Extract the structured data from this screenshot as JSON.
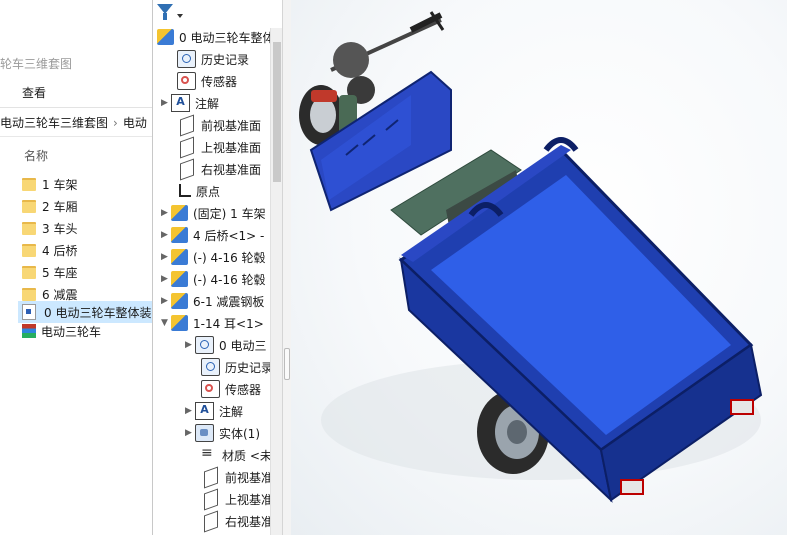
{
  "explorer": {
    "title": "轮车三维套图",
    "ribbon_tab": "查看",
    "breadcrumb": [
      "电动三轮车三维套图",
      "电动"
    ],
    "column_header": "名称",
    "items": [
      {
        "name": "1 车架",
        "type": "folder"
      },
      {
        "name": "2 车厢",
        "type": "folder"
      },
      {
        "name": "3 车头",
        "type": "folder"
      },
      {
        "name": "4 后桥",
        "type": "folder"
      },
      {
        "name": "5 车座",
        "type": "folder"
      },
      {
        "name": "6 减震",
        "type": "folder"
      },
      {
        "name": "0 电动三轮车整体装",
        "type": "assembly",
        "selected": true
      },
      {
        "name": "电动三轮车",
        "type": "archive"
      }
    ]
  },
  "tree": {
    "filter_icon": "filter-icon",
    "root": "0 电动三轮车整体",
    "top_items": [
      {
        "label": "历史记录",
        "icon": "history-icon"
      },
      {
        "label": "传感器",
        "icon": "sensor-icon"
      },
      {
        "label": "注解",
        "icon": "annotation-icon",
        "expandable": true
      },
      {
        "label": "前视基准面",
        "icon": "plane-icon"
      },
      {
        "label": "上视基准面",
        "icon": "plane-icon"
      },
      {
        "label": "右视基准面",
        "icon": "plane-icon"
      },
      {
        "label": "原点",
        "icon": "origin-icon"
      },
      {
        "label": "(固定) 1 车架",
        "icon": "part-icon",
        "expandable": true
      },
      {
        "label": "4 后桥<1> -",
        "icon": "part-icon",
        "expandable": true
      },
      {
        "label": "(-) 4-16 轮毂",
        "icon": "part-icon",
        "expandable": true
      },
      {
        "label": "(-) 4-16 轮毂",
        "icon": "part-icon",
        "expandable": true
      },
      {
        "label": "6-1 减震钢板",
        "icon": "part-icon",
        "expandable": true
      },
      {
        "label": "1-14 耳<1>",
        "icon": "part-icon",
        "expanded": true
      }
    ],
    "sub_items": [
      {
        "label": "0 电动三",
        "icon": "history-icon",
        "expandable": true
      },
      {
        "label": "历史记录",
        "icon": "history-icon"
      },
      {
        "label": "传感器",
        "icon": "sensor-icon"
      },
      {
        "label": "注解",
        "icon": "annotation-icon",
        "expandable": true
      },
      {
        "label": "实体(1)",
        "icon": "solid-body-icon",
        "expandable": true
      },
      {
        "label": "材质 <未",
        "icon": "material-icon"
      },
      {
        "label": "前视基准",
        "icon": "plane-icon"
      },
      {
        "label": "上视基准",
        "icon": "plane-icon"
      },
      {
        "label": "右视基准",
        "icon": "plane-icon"
      }
    ]
  },
  "viewport": {
    "model": "electric-tricycle-3d-model",
    "colors": {
      "body": "#1f3fb0",
      "body_dark": "#102a7a",
      "cargo_floor": "#2f5fe8",
      "tire": "#2b2b2b",
      "seat": "#5a7a6a"
    }
  }
}
